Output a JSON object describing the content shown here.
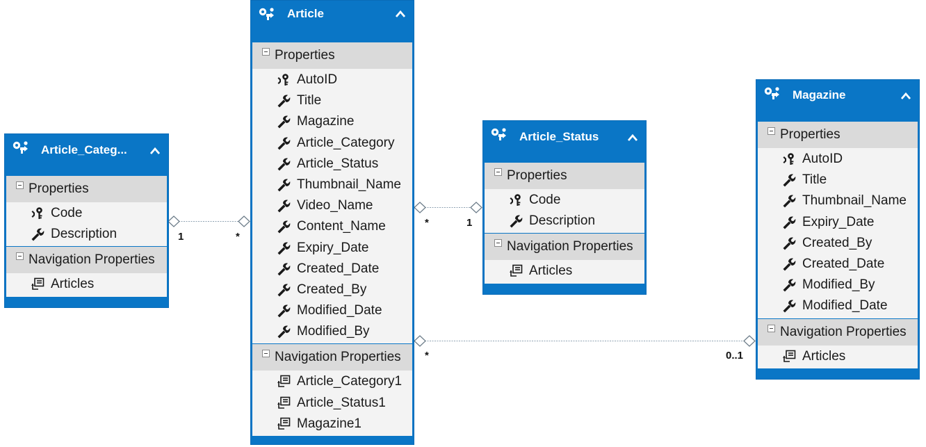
{
  "section_labels": {
    "properties": "Properties",
    "navigation": "Navigation Properties"
  },
  "entities": {
    "article": {
      "title": "Article",
      "properties": [
        "AutoID",
        "Title",
        "Magazine",
        "Article_Category",
        "Article_Status",
        "Thumbnail_Name",
        "Video_Name",
        "Content_Name",
        "Expiry_Date",
        "Created_Date",
        "Created_By",
        "Modified_Date",
        "Modified_By"
      ],
      "navigation": [
        "Article_Category1",
        "Article_Status1",
        "Magazine1"
      ]
    },
    "article_category": {
      "title": "Article_Categ...",
      "properties": [
        "Code",
        "Description"
      ],
      "navigation": [
        "Articles"
      ]
    },
    "article_status": {
      "title": "Article_Status",
      "properties": [
        "Code",
        "Description"
      ],
      "navigation": [
        "Articles"
      ]
    },
    "magazine": {
      "title": "Magazine",
      "properties": [
        "AutoID",
        "Title",
        "Thumbnail_Name",
        "Expiry_Date",
        "Created_By",
        "Created_Date",
        "Modified_By",
        "Modified_Date"
      ],
      "navigation": [
        "Articles"
      ]
    }
  },
  "associations": [
    {
      "from": "article_category",
      "to": "article",
      "from_multiplicity": "1",
      "to_multiplicity": "*"
    },
    {
      "from": "article",
      "to": "article_status",
      "from_multiplicity": "*",
      "to_multiplicity": "1"
    },
    {
      "from": "article",
      "to": "magazine",
      "from_multiplicity": "*",
      "to_multiplicity": "0..1"
    }
  ],
  "colors": {
    "header": "#0a76c6",
    "section_header": "#dadada",
    "body": "#f3f3f3",
    "connector": "#8fa3b3"
  },
  "icons": {
    "entity": "entity-type-icon",
    "key": "key-icon",
    "property": "wrench-icon",
    "navigation": "navigation-property-icon",
    "collapse": "chevron-up-icon",
    "section_toggle": "minus-box-icon"
  }
}
